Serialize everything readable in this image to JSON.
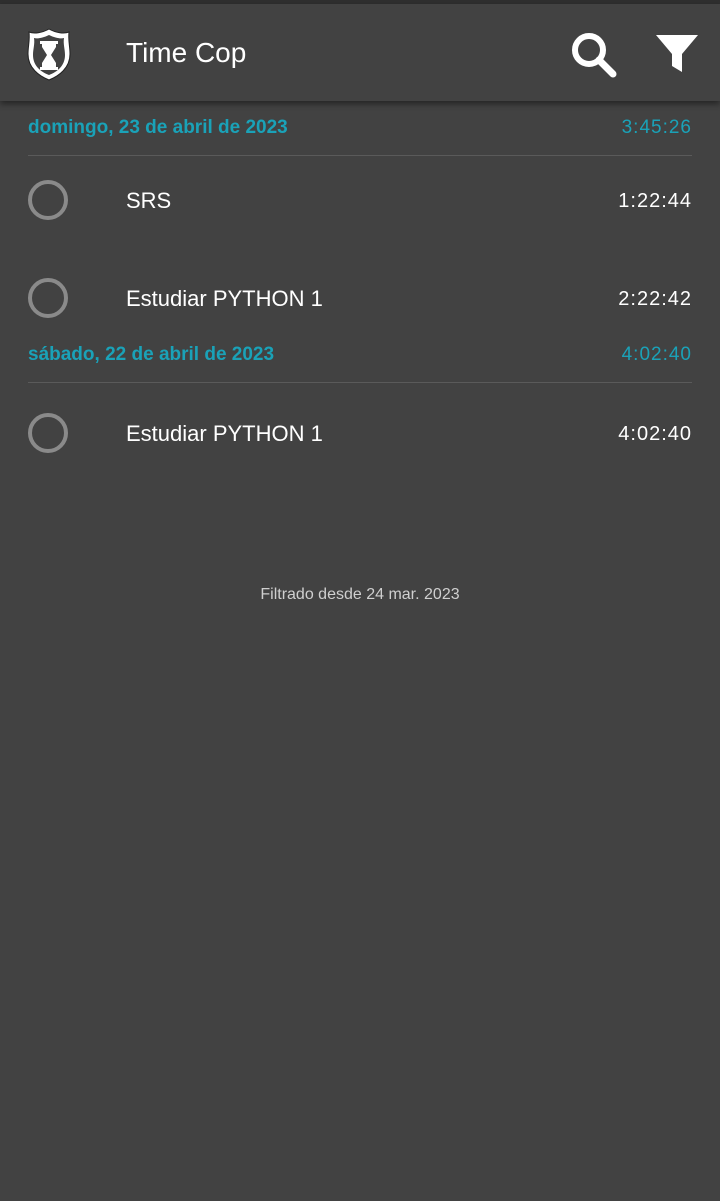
{
  "app_bar": {
    "title": "Time Cop",
    "logo_icon": "shield-hourglass-icon",
    "search_icon": "search-icon",
    "filter_icon": "filter-icon"
  },
  "days": [
    {
      "date": "domingo, 23 de abril de 2023",
      "total": "3:45:26",
      "entries": [
        {
          "name": "SRS",
          "duration": "1:22:44"
        },
        {
          "name": "Estudiar PYTHON 1",
          "duration": "2:22:42"
        }
      ]
    },
    {
      "date": "sábado, 22 de abril de 2023",
      "total": "4:02:40",
      "entries": [
        {
          "name": "Estudiar PYTHON 1",
          "duration": "4:02:40"
        }
      ]
    }
  ],
  "filter_note": "Filtrado desde 24 mar. 2023",
  "colors": {
    "background": "#424242",
    "accent": "#1aa2b8",
    "circle": "#8a8a8a",
    "divider": "#5a5a5a"
  }
}
